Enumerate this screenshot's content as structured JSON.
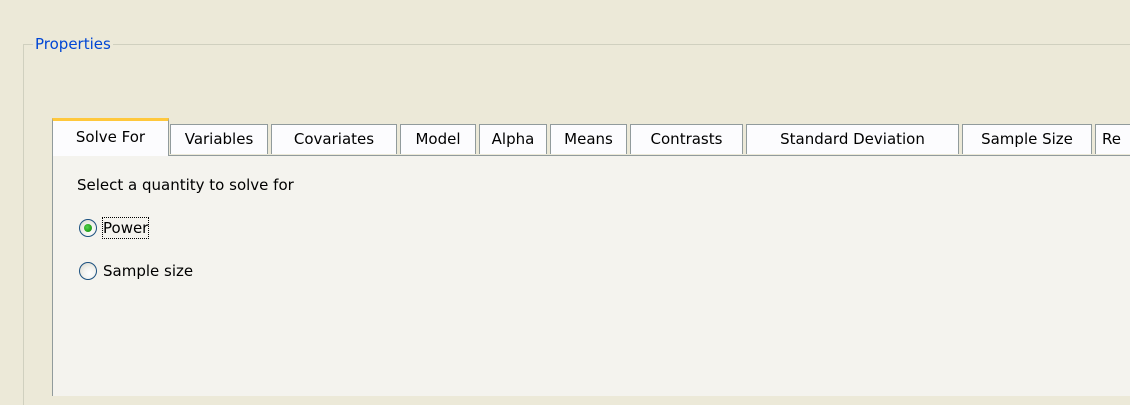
{
  "group": {
    "title": "Properties"
  },
  "tabs": [
    {
      "label": "Solve For",
      "active": true
    },
    {
      "label": "Variables",
      "active": false
    },
    {
      "label": "Covariates",
      "active": false
    },
    {
      "label": "Model",
      "active": false
    },
    {
      "label": "Alpha",
      "active": false
    },
    {
      "label": "Means",
      "active": false
    },
    {
      "label": "Contrasts",
      "active": false
    },
    {
      "label": "Standard Deviation",
      "active": false
    },
    {
      "label": "Sample Size",
      "active": false
    },
    {
      "label": "Re",
      "active": false
    }
  ],
  "panel": {
    "instruction": "Select a quantity to solve for",
    "options": [
      {
        "label": "Power",
        "selected": true,
        "focused": true
      },
      {
        "label": "Sample size",
        "selected": false,
        "focused": false
      }
    ]
  },
  "colors": {
    "window_bg": "#ece9d8",
    "panel_bg": "#f4f3ee",
    "group_title": "#0046d5",
    "active_tab_accent": "#ffc83c",
    "radio_dot": "#2aaa1f"
  }
}
